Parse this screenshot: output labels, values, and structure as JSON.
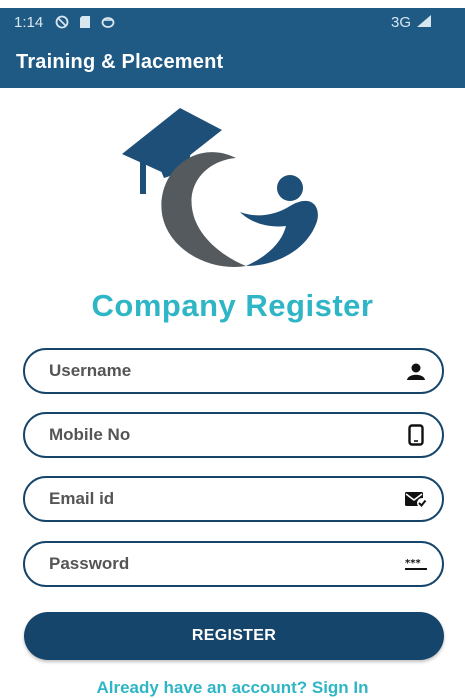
{
  "status_bar": {
    "time": "1:14",
    "network": "3G",
    "icons": [
      "do-not-disturb-icon",
      "sd-card-icon",
      "sync-icon",
      "signal-icon"
    ]
  },
  "app_bar": {
    "title": "Training & Placement"
  },
  "logo": {
    "name": "graduation-cap-logo",
    "colors": {
      "cap": "#1e4f78",
      "arc": "#555a5e",
      "person": "#1e4f78"
    }
  },
  "page": {
    "title": "Company Register"
  },
  "form": {
    "username": {
      "placeholder": "Username",
      "value": "",
      "icon": "person-icon"
    },
    "mobile": {
      "placeholder": "Mobile No",
      "value": "",
      "icon": "phone-icon"
    },
    "email": {
      "placeholder": "Email id",
      "value": "",
      "icon": "mail-check-icon"
    },
    "password": {
      "placeholder": "Password",
      "value": "",
      "icon": "password-dots-icon"
    }
  },
  "register_button": {
    "label": "REGISTER"
  },
  "signin_link": {
    "label": "Already have an account? Sign In"
  },
  "colors": {
    "primary": "#1e5a84",
    "accent": "#2fb6c6",
    "button": "#16456c"
  }
}
